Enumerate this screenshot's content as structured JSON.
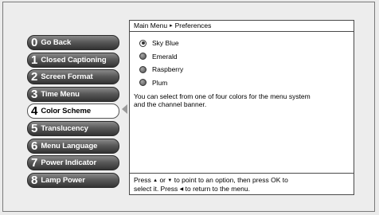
{
  "menu": {
    "items": [
      {
        "num": "0",
        "label": "Go Back",
        "selected": false
      },
      {
        "num": "1",
        "label": "Closed Captioning",
        "selected": false
      },
      {
        "num": "2",
        "label": "Screen Format",
        "selected": false
      },
      {
        "num": "3",
        "label": "Time Menu",
        "selected": false
      },
      {
        "num": "4",
        "label": "Color Scheme",
        "selected": true
      },
      {
        "num": "5",
        "label": "Translucency",
        "selected": false
      },
      {
        "num": "6",
        "label": "Menu Language",
        "selected": false
      },
      {
        "num": "7",
        "label": "Power Indicator",
        "selected": false
      },
      {
        "num": "8",
        "label": "Lamp Power",
        "selected": false
      }
    ]
  },
  "panel": {
    "breadcrumb": {
      "root": "Main Menu",
      "separator": "▸",
      "current": "Preferences"
    },
    "options": [
      {
        "label": "Sky Blue",
        "checked": true
      },
      {
        "label": "Emerald",
        "checked": false
      },
      {
        "label": "Raspberry",
        "checked": false
      },
      {
        "label": "Plum",
        "checked": false
      }
    ],
    "description_line1": "You can select from one of four colors for the menu system",
    "description_line2": "and the channel banner.",
    "help": {
      "p1": "Press",
      "up": "▲",
      "p2": "or",
      "down": "▼",
      "p3": "to point to an option, then press OK to",
      "p4": "select it. Press",
      "left": "◀",
      "p5": "to return to the menu."
    }
  },
  "colors": {
    "background": "#ebebeb",
    "button_dark": "#333333",
    "button_selected": "#ffffff"
  }
}
